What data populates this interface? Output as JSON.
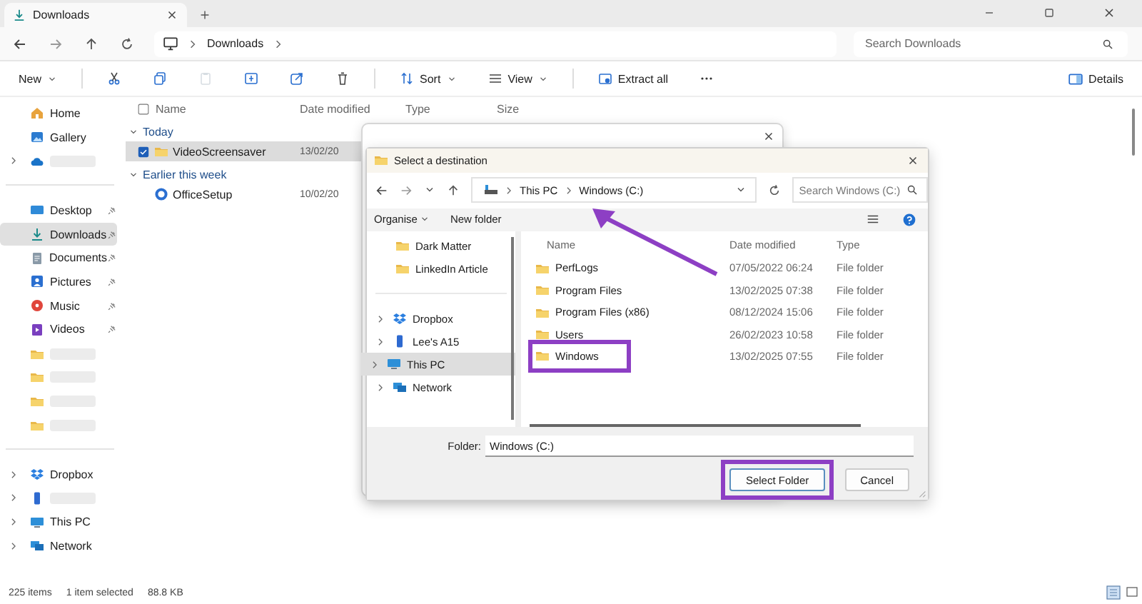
{
  "window": {
    "tab_title": "Downloads",
    "crumbs": [
      "Downloads"
    ],
    "search_placeholder": "Search Downloads"
  },
  "toolbar": {
    "items": [
      {
        "kind": "new",
        "label": "New",
        "disabled": false
      },
      {
        "kind": "cut",
        "disabled": false
      },
      {
        "kind": "copy",
        "disabled": false
      },
      {
        "kind": "paste",
        "disabled": true
      },
      {
        "kind": "rename",
        "disabled": false
      },
      {
        "kind": "share",
        "disabled": false
      },
      {
        "kind": "delete",
        "disabled": false
      },
      {
        "kind": "sort",
        "label": "Sort",
        "disabled": false
      },
      {
        "kind": "view",
        "label": "View",
        "disabled": false
      },
      {
        "kind": "extract",
        "label": "Extract all",
        "disabled": false
      },
      {
        "kind": "more",
        "disabled": false
      }
    ],
    "details": "Details"
  },
  "sidebar": {
    "sections": [
      [
        {
          "kind": "home",
          "label": "Home",
          "pinned": false,
          "selected": false,
          "expandable": false,
          "redacted": false
        },
        {
          "kind": "gallery",
          "label": "Gallery",
          "pinned": false,
          "selected": false,
          "expandable": false,
          "redacted": false
        },
        {
          "kind": "cloud",
          "pinned": false,
          "selected": false,
          "expandable": true,
          "redacted": true
        }
      ],
      [
        {
          "kind": "desktop",
          "label": "Desktop",
          "pinned": true,
          "selected": false,
          "expandable": false,
          "redacted": false
        },
        {
          "kind": "download",
          "label": "Downloads",
          "pinned": true,
          "selected": true,
          "expandable": false,
          "redacted": false
        },
        {
          "kind": "documents",
          "label": "Documents",
          "pinned": true,
          "selected": false,
          "expandable": false,
          "redacted": false
        },
        {
          "kind": "pictures",
          "label": "Pictures",
          "pinned": true,
          "selected": false,
          "expandable": false,
          "redacted": false
        },
        {
          "kind": "music",
          "label": "Music",
          "pinned": true,
          "selected": false,
          "expandable": false,
          "redacted": false
        },
        {
          "kind": "videos",
          "label": "Videos",
          "pinned": true,
          "selected": false,
          "expandable": false,
          "redacted": false
        },
        {
          "kind": "folder",
          "pinned": false,
          "selected": false,
          "expandable": false,
          "redacted": true
        },
        {
          "kind": "folder",
          "pinned": false,
          "selected": false,
          "expandable": false,
          "redacted": true
        },
        {
          "kind": "folder",
          "pinned": false,
          "selected": false,
          "expandable": false,
          "redacted": true
        },
        {
          "kind": "folder",
          "pinned": false,
          "selected": false,
          "expandable": false,
          "redacted": true
        }
      ],
      [
        {
          "kind": "dropbox",
          "label": "Dropbox",
          "pinned": false,
          "selected": false,
          "expandable": true,
          "redacted": false
        },
        {
          "kind": "phone",
          "pinned": false,
          "selected": false,
          "expandable": true,
          "redacted": true
        },
        {
          "kind": "pc",
          "label": "This PC",
          "pinned": false,
          "selected": false,
          "expandable": true,
          "redacted": false
        },
        {
          "kind": "network",
          "label": "Network",
          "pinned": false,
          "selected": false,
          "expandable": true,
          "redacted": false
        }
      ]
    ]
  },
  "file_list": {
    "columns": [
      "Name",
      "Date modified",
      "Type",
      "Size"
    ],
    "groups": [
      {
        "label": "Today",
        "rows": [
          {
            "kind": "folder",
            "name": "VideoScreensaver",
            "date": "13/02/20",
            "selected": true
          }
        ]
      },
      {
        "label": "Earlier this week",
        "rows": [
          {
            "kind": "office",
            "name": "OfficeSetup",
            "date": "10/02/20",
            "selected": false
          }
        ]
      }
    ]
  },
  "status_bar": {
    "count": "225 items",
    "selection": "1 item selected",
    "size": "88.8 KB"
  },
  "dialog": {
    "title": "Select a destination",
    "path": [
      "This PC",
      "Windows (C:)"
    ],
    "path_annotated": true,
    "search_placeholder": "Search Windows (C:)",
    "organise": "Organise",
    "new_folder": "New folder",
    "nav": [
      [
        {
          "kind": "folder",
          "label": "Dark Matter",
          "expandable": false,
          "selected": false,
          "highlighted": false
        },
        {
          "kind": "folder",
          "label": "LinkedIn Article",
          "expandable": false,
          "selected": false,
          "highlighted": false
        }
      ],
      [
        {
          "kind": "dropbox",
          "label": "Dropbox",
          "expandable": true,
          "selected": false,
          "highlighted": false
        },
        {
          "kind": "phone",
          "label": "Lee's A15",
          "expandable": true,
          "selected": false,
          "highlighted": false
        },
        {
          "kind": "pc",
          "label": "This PC",
          "expandable": true,
          "selected": true,
          "highlighted": true
        },
        {
          "kind": "network",
          "label": "Network",
          "expandable": true,
          "selected": false,
          "highlighted": false
        }
      ]
    ],
    "columns": [
      "Name",
      "Date modified",
      "Type"
    ],
    "rows": [
      {
        "name": "PerfLogs",
        "date": "07/05/2022 06:24",
        "type": "File folder",
        "highlighted": false
      },
      {
        "name": "Program Files",
        "date": "13/02/2025 07:38",
        "type": "File folder",
        "highlighted": false
      },
      {
        "name": "Program Files (x86)",
        "date": "08/12/2024 15:06",
        "type": "File folder",
        "highlighted": false
      },
      {
        "name": "Users",
        "date": "26/02/2023 10:58",
        "type": "File folder",
        "highlighted": false
      },
      {
        "name": "Windows",
        "date": "13/02/2025 07:55",
        "type": "File folder",
        "highlighted": true
      }
    ],
    "folder_label": "Folder:",
    "folder_value": "Windows (C:)",
    "buttons": [
      {
        "label": "Select Folder",
        "kind": "primary",
        "highlighted": true
      },
      {
        "label": "Cancel",
        "kind": "secondary",
        "highlighted": false
      }
    ]
  }
}
